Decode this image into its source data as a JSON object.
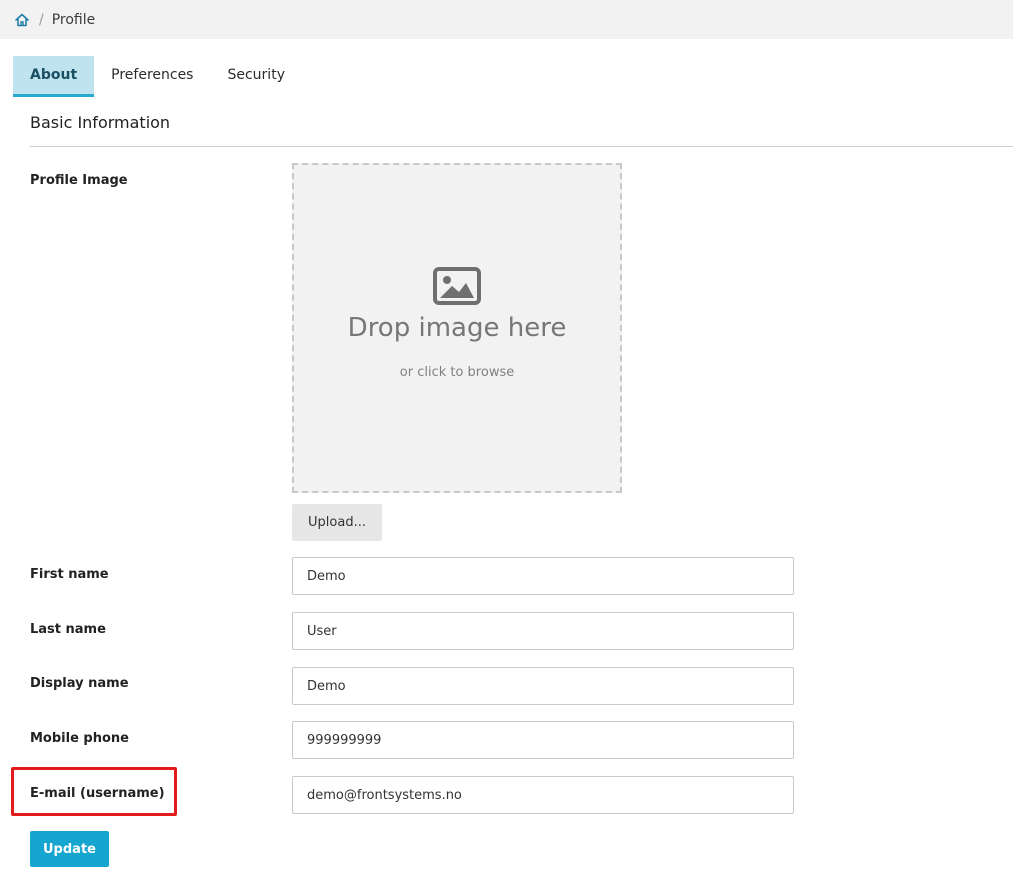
{
  "breadcrumb": {
    "home_icon": "home-icon",
    "separator": "/",
    "current": "Profile"
  },
  "tabs": [
    {
      "label": "About",
      "active": true
    },
    {
      "label": "Preferences",
      "active": false
    },
    {
      "label": "Security",
      "active": false
    }
  ],
  "section": {
    "title": "Basic Information"
  },
  "profile_image": {
    "label": "Profile Image",
    "icon": "image-icon",
    "drop_text": "Drop image here",
    "browse_text": "or click to browse",
    "upload_label": "Upload..."
  },
  "fields": {
    "first_name": {
      "label": "First name",
      "value": "Demo"
    },
    "last_name": {
      "label": "Last name",
      "value": "User"
    },
    "display_name": {
      "label": "Display name",
      "value": "Demo"
    },
    "mobile_phone": {
      "label": "Mobile phone",
      "value": "999999999"
    },
    "email": {
      "label": "E-mail (username)",
      "value": "demo@frontsystems.no"
    }
  },
  "actions": {
    "update_label": "Update"
  },
  "colors": {
    "accent": "#16a5cf",
    "active_tab_bg": "#bfe3ef",
    "highlight": "#e31b1b"
  }
}
